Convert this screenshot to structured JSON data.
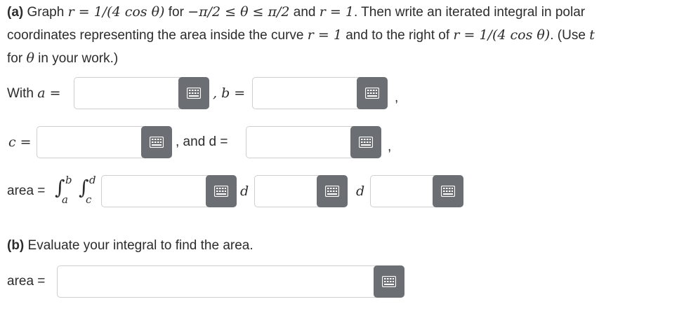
{
  "problem": {
    "part_a_label": "(a)",
    "line1_text1": " Graph ",
    "line1_math1": "r = 1/(4 cos θ)",
    "line1_text2": " for ",
    "line1_math2": "−π/2 ≤ θ ≤ π/2",
    "line1_text3": " and ",
    "line1_math3": "r = 1",
    "line1_text4": ". Then write an iterated integral in polar",
    "line2_text1": "coordinates representing the area inside the curve ",
    "line2_math1": "r = 1",
    "line2_text2": " and to the right of ",
    "line2_math2": "r = 1/(4 cos θ)",
    "line2_text3": ". (Use ",
    "line2_math3": "t",
    "line3_text1": "for ",
    "line3_math1": "θ",
    "line3_text2": " in your work.)"
  },
  "bounds": {
    "with_label": "With ",
    "a_label": "a =",
    "b_label": ", b =",
    "comma1": ",",
    "c_label": "c =",
    "and_d_label": ", and d =",
    "comma2": ",",
    "a_value": "",
    "b_value": "",
    "c_value": "",
    "d_value": ""
  },
  "integral": {
    "area_label": "area =",
    "int_symbol_outer": "∫",
    "lower_outer": "a",
    "upper_outer": "b",
    "int_symbol_inner": "∫",
    "lower_inner": "c",
    "upper_inner": "d",
    "d1": "d",
    "d2": "d",
    "integrand_value": "",
    "var1_value": "",
    "var2_value": ""
  },
  "part_b": {
    "label": "(b)",
    "text": " Evaluate your integral to find the area.",
    "area_label": "area =",
    "area_value": ""
  },
  "icons": {
    "keyboard": "keyboard-icon"
  },
  "colors": {
    "button_bg": "#6b6e72",
    "field_border": "#cfcfcf"
  }
}
